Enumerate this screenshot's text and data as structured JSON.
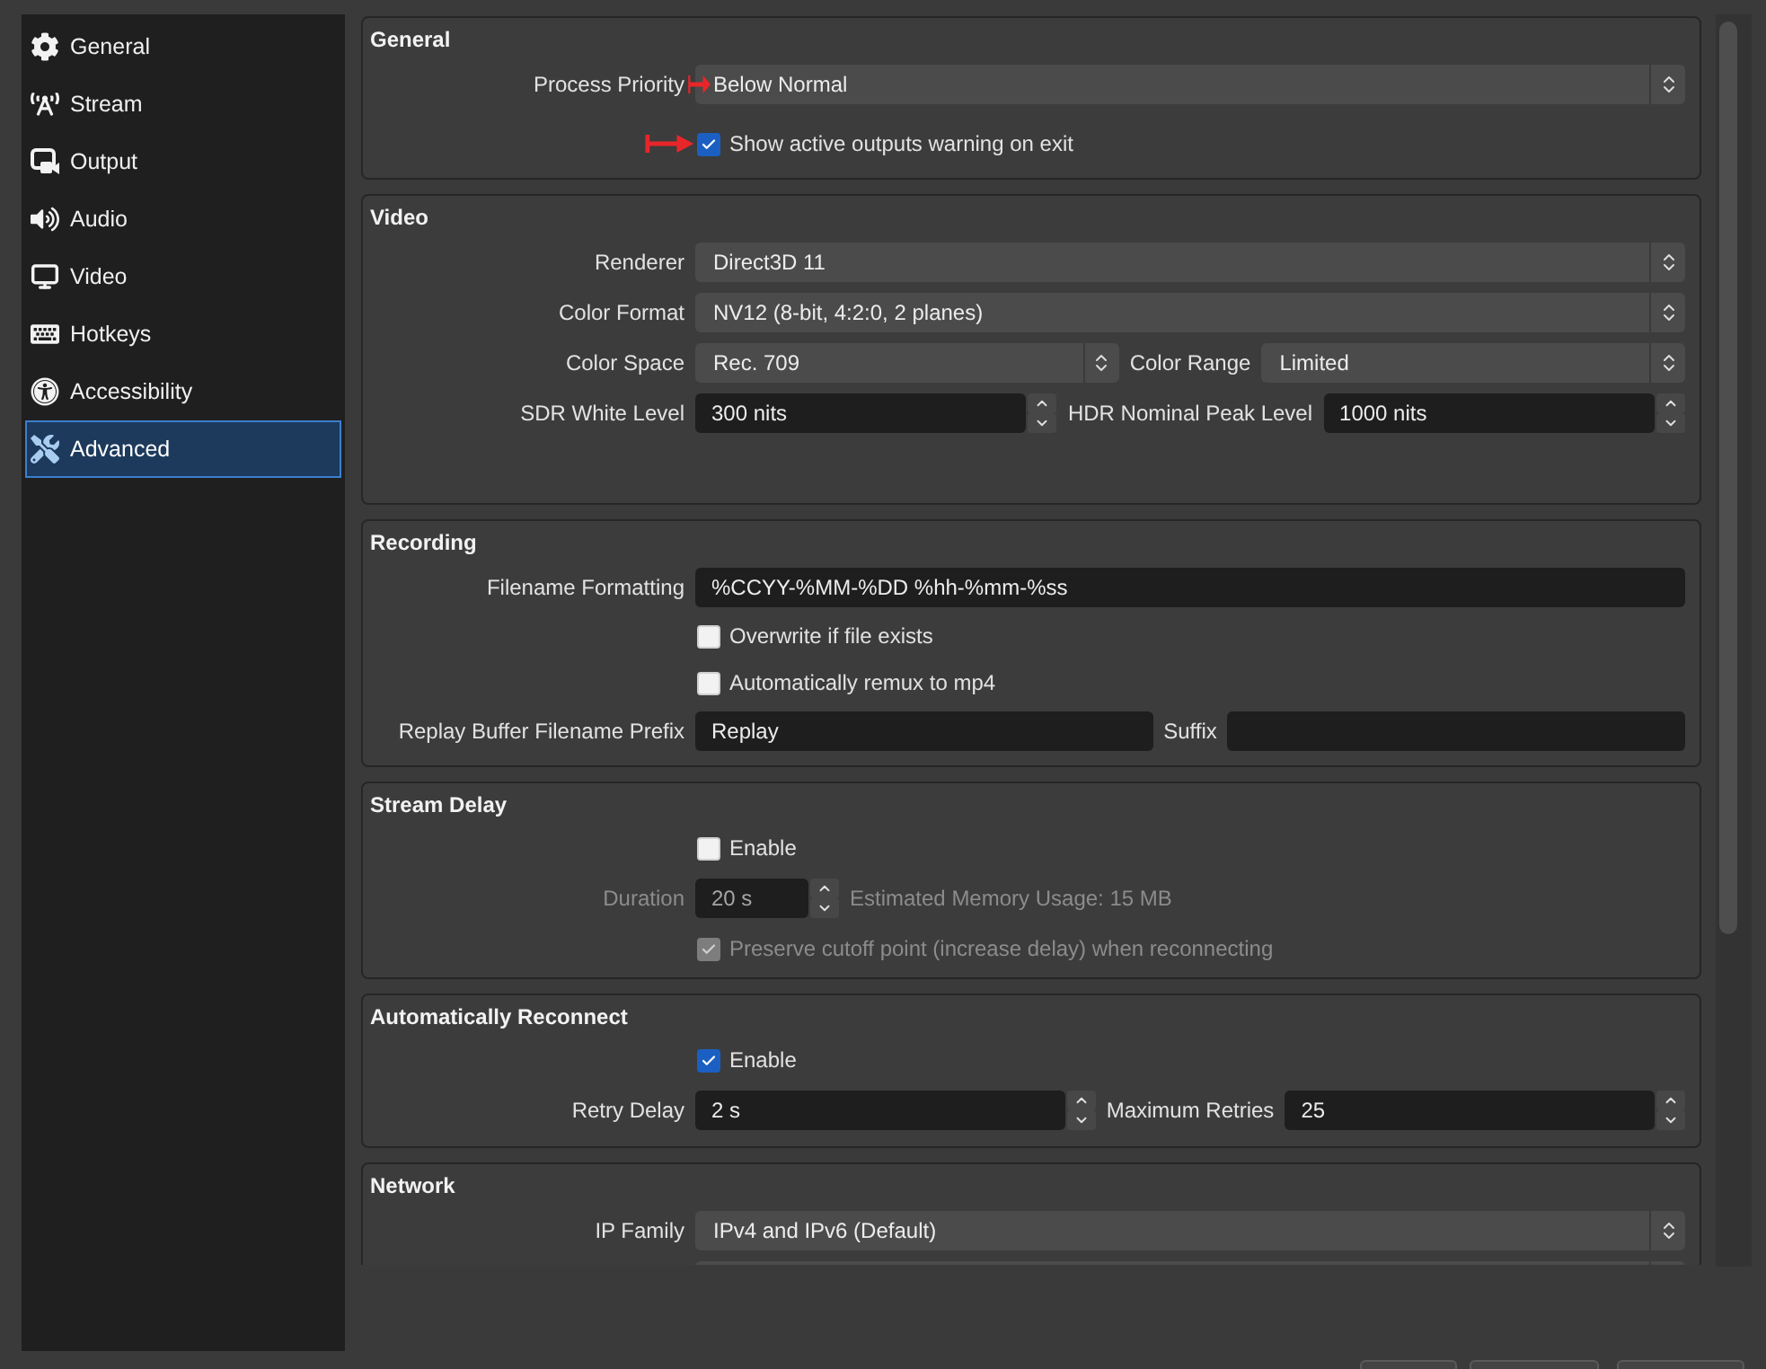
{
  "sidebar": {
    "items": [
      {
        "label": "General",
        "selected": false
      },
      {
        "label": "Stream",
        "selected": false
      },
      {
        "label": "Output",
        "selected": false
      },
      {
        "label": "Audio",
        "selected": false
      },
      {
        "label": "Video",
        "selected": false
      },
      {
        "label": "Hotkeys",
        "selected": false
      },
      {
        "label": "Accessibility",
        "selected": false
      },
      {
        "label": "Advanced",
        "selected": true
      }
    ]
  },
  "sections": [
    {
      "title": "General",
      "rows": [
        {
          "kind": "select",
          "label": "Process Priority",
          "value": "Below Normal",
          "annotated": true
        },
        {
          "kind": "checkbox",
          "label": "Show active outputs warning on exit",
          "checked": true,
          "annotated": true
        }
      ]
    },
    {
      "title": "Video",
      "rows": [
        {
          "kind": "select",
          "label": "Renderer",
          "value": "Direct3D 11"
        },
        {
          "kind": "select",
          "label": "Color Format",
          "value": "NV12 (8-bit, 4:2:0, 2 planes)"
        },
        {
          "kind": "pair",
          "fields": [
            {
              "kind": "select",
              "label": "Color Space",
              "value": "Rec. 709"
            },
            {
              "kind": "select",
              "label": "Color Range",
              "value": "Limited"
            }
          ]
        },
        {
          "kind": "pair",
          "fields": [
            {
              "kind": "spin",
              "label": "SDR White Level",
              "value": "300 nits"
            },
            {
              "kind": "spin",
              "label": "HDR Nominal Peak Level",
              "value": "1000 nits"
            }
          ]
        }
      ]
    },
    {
      "title": "Recording",
      "rows": [
        {
          "kind": "text",
          "label": "Filename Formatting",
          "value": "%CCYY-%MM-%DD %hh-%mm-%ss"
        },
        {
          "kind": "checkbox",
          "label": "Overwrite if file exists",
          "checked": false
        },
        {
          "kind": "checkbox",
          "label": "Automatically remux to mp4",
          "checked": false
        },
        {
          "kind": "pair",
          "fields": [
            {
              "kind": "text",
              "label": "Replay Buffer Filename Prefix",
              "value": "Replay"
            },
            {
              "kind": "text",
              "label": "Suffix"
            }
          ]
        }
      ]
    },
    {
      "title": "Stream Delay",
      "rows": [
        {
          "kind": "checkbox",
          "label": "Enable",
          "checked": false,
          "disabled": false
        },
        {
          "kind": "spin",
          "label": "Duration",
          "value": "20 s",
          "note": "Estimated Memory Usage: 15 MB",
          "disabled": true
        },
        {
          "kind": "checkbox",
          "label": "Preserve cutoff point (increase delay) when reconnecting",
          "checked": true,
          "disabled": true
        }
      ]
    },
    {
      "title": "Automatically Reconnect",
      "rows": [
        {
          "kind": "checkbox",
          "label": "Enable",
          "checked": true
        },
        {
          "kind": "pair",
          "fields": [
            {
              "kind": "spin",
              "label": "Retry Delay",
              "value": "2 s"
            },
            {
              "kind": "spin",
              "label": "Maximum Retries",
              "value": "25"
            }
          ]
        }
      ]
    },
    {
      "title": "Network",
      "rows": [
        {
          "kind": "select",
          "label": "IP Family",
          "value": "IPv4 and IPv6 (Default)"
        },
        {
          "kind": "select"
        }
      ]
    }
  ]
}
